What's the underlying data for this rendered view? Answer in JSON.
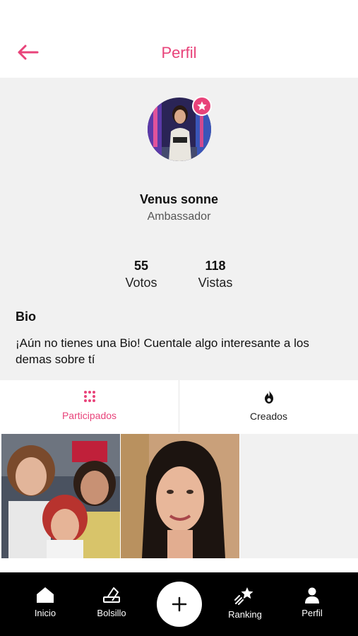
{
  "header": {
    "title": "Perfil",
    "back_icon": "arrow-left-icon",
    "accent_color": "#e8437a"
  },
  "profile": {
    "name": "Venus sonne",
    "role": "Ambassador",
    "badge_icon": "star-icon",
    "stats": [
      {
        "value": "55",
        "label": "Votos"
      },
      {
        "value": "118",
        "label": "Vistas"
      }
    ],
    "bio_heading": "Bio",
    "bio_text": "¡Aún no tienes una Bio! Cuentale algo interesante a los demas sobre tí"
  },
  "tabs": [
    {
      "label": "Participados",
      "icon": "grid-dots-icon",
      "active": true
    },
    {
      "label": "Creados",
      "icon": "flame-icon",
      "active": false
    }
  ],
  "bottom_nav": [
    {
      "label": "Inicio",
      "icon": "home-icon"
    },
    {
      "label": "Bolsillo",
      "icon": "wallet-icon"
    },
    {
      "label": "",
      "icon": "plus-icon"
    },
    {
      "label": "Ranking",
      "icon": "shooting-star-icon"
    },
    {
      "label": "Perfil",
      "icon": "user-icon"
    }
  ]
}
